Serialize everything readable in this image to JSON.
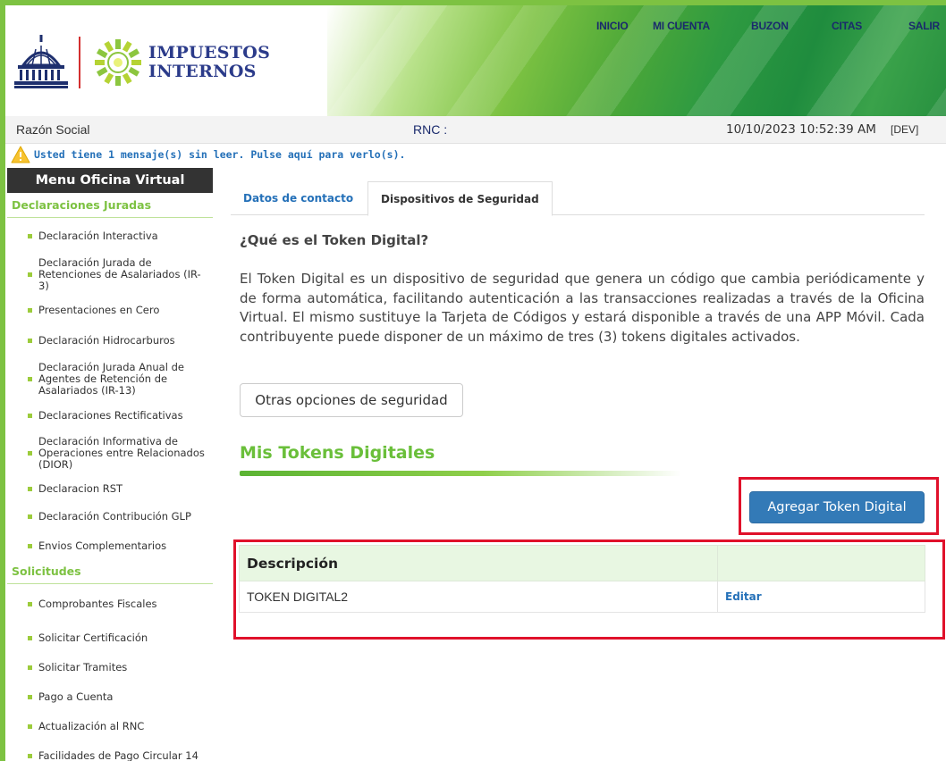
{
  "header": {
    "logo_text_line1": "IMPUESTOS",
    "logo_text_line2": "INTERNOS",
    "nav": [
      "INICIO",
      "MI CUENTA",
      "BUZON",
      "CITAS",
      "SALIR"
    ]
  },
  "infobar": {
    "razon_social": "Razón Social",
    "rnc": "RNC :",
    "datetime": "10/10/2023 10:52:39 AM",
    "env": "[DEV]"
  },
  "message": {
    "text": "Usted tiene 1 mensaje(s) sin leer. Pulse aquí para verlo(s)."
  },
  "sidebar": {
    "title": "Menu Oficina Virtual",
    "section_declaraciones": "Declaraciones Juradas",
    "declaraciones": [
      "Declaración Interactiva",
      "Declaración Jurada de Retenciones de Asalariados (IR-3)",
      "Presentaciones en Cero",
      "Declaración Hidrocarburos",
      "Declaración Jurada Anual de Agentes de Retención de Asalariados (IR-13)",
      "Declaraciones Rectificativas",
      "Declaración Informativa de Operaciones entre Relacionados (DIOR)",
      "Declaracion RST",
      "Declaración Contribución GLP",
      "Envios Complementarios"
    ],
    "section_solicitudes": "Solicitudes",
    "solicitudes": [
      "Comprobantes Fiscales",
      "Solicitar Certificación",
      "Solicitar Tramites",
      "Pago a Cuenta",
      "Actualización al RNC",
      "Facilidades de Pago Circular 14"
    ]
  },
  "tabs": {
    "contacto": "Datos de contacto",
    "dispositivos": "Dispositivos de Seguridad"
  },
  "main": {
    "heading": "¿Qué es el Token Digital?",
    "description": "El Token Digital es un dispositivo de seguridad que genera un código que cambia periódicamente y de forma automática, facilitando autenticación a las transacciones realizadas a través de la Oficina Virtual. El mismo sustituye la Tarjeta de Códigos y estará disponible a través de una APP Móvil. Cada contribuyente puede disponer de un máximo de tres (3) tokens digitales activados.",
    "otras_button": "Otras opciones de seguridad",
    "mis_tokens_title": "Mis Tokens Digitales",
    "agregar_button": "Agregar Token Digital",
    "table": {
      "header_descripcion": "Descripción",
      "header_actions": "",
      "rows": [
        {
          "descripcion": "TOKEN DIGITAL2",
          "action": "Editar"
        }
      ]
    }
  },
  "colors": {
    "brand_green": "#7dc242",
    "link_blue": "#2470b8",
    "primary_button": "#337ab7",
    "highlight_red": "#e0112b"
  }
}
